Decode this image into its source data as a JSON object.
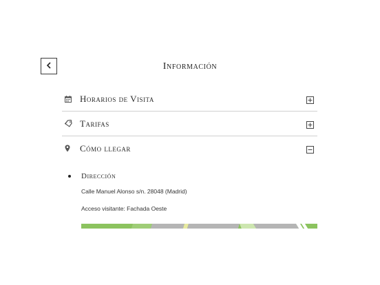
{
  "header": {
    "title": "Información",
    "back_icon": "chevron-left-icon"
  },
  "accordion": {
    "items": [
      {
        "label": "Horarios de Visita",
        "icon": "calendar-icon",
        "expanded": false,
        "toggle_icon": "plus-square-icon"
      },
      {
        "label": "Tarifas",
        "icon": "tag-icon",
        "expanded": false,
        "toggle_icon": "plus-square-icon"
      },
      {
        "label": "Cómo llegar",
        "icon": "map-pin-icon",
        "expanded": true,
        "toggle_icon": "minus-square-icon"
      }
    ]
  },
  "directions": {
    "heading": "Dirección",
    "address": "Calle Manuel Alonso s/n. 28048 (Madrid)",
    "access": "Acceso visitante: Fachada Oeste"
  },
  "colors": {
    "text": "#2a2a2a",
    "divider": "#cfcfcf",
    "map_green": "#8cc35f",
    "map_road": "#b5b5b5"
  }
}
